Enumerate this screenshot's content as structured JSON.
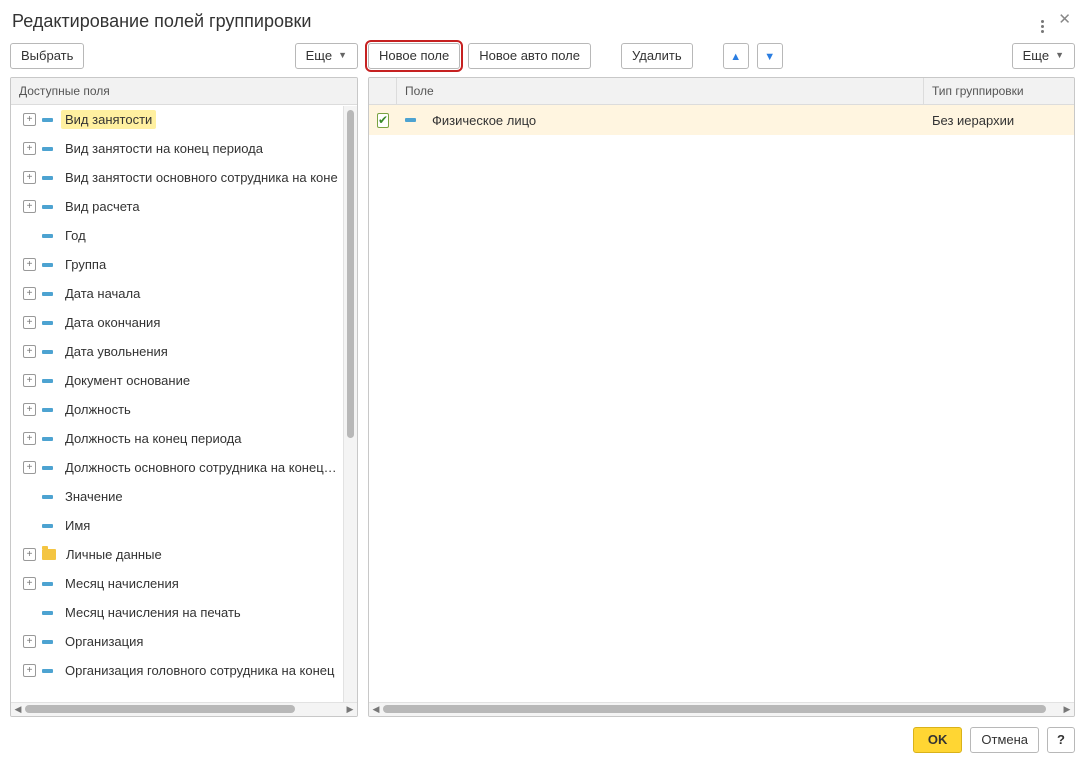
{
  "title": "Редактирование полей группировки",
  "left_toolbar": {
    "select": "Выбрать",
    "more": "Еще"
  },
  "right_toolbar": {
    "new_field": "Новое поле",
    "new_auto_field": "Новое авто поле",
    "delete": "Удалить",
    "more": "Еще"
  },
  "left_header": "Доступные поля",
  "right_header": {
    "field": "Поле",
    "group_type": "Тип группировки"
  },
  "available_fields": [
    {
      "label": "Вид занятости",
      "expandable": true,
      "selected": true
    },
    {
      "label": "Вид занятости на конец периода",
      "expandable": true
    },
    {
      "label": "Вид занятости основного сотрудника на коне",
      "expandable": true
    },
    {
      "label": "Вид расчета",
      "expandable": true
    },
    {
      "label": "Год",
      "expandable": false
    },
    {
      "label": "Группа",
      "expandable": true
    },
    {
      "label": "Дата начала",
      "expandable": true
    },
    {
      "label": "Дата окончания",
      "expandable": true
    },
    {
      "label": "Дата увольнения",
      "expandable": true
    },
    {
      "label": "Документ основание",
      "expandable": true
    },
    {
      "label": "Должность",
      "expandable": true
    },
    {
      "label": "Должность на конец периода",
      "expandable": true
    },
    {
      "label": "Должность основного сотрудника на конец пе",
      "expandable": true
    },
    {
      "label": "Значение",
      "expandable": false
    },
    {
      "label": "Имя",
      "expandable": false
    },
    {
      "label": "Личные данные",
      "expandable": true,
      "folder": true
    },
    {
      "label": "Месяц начисления",
      "expandable": true
    },
    {
      "label": "Месяц начисления на печать",
      "expandable": false
    },
    {
      "label": "Организация",
      "expandable": true
    },
    {
      "label": "Организация головного сотрудника на конец",
      "expandable": true
    }
  ],
  "group_fields": [
    {
      "checked": true,
      "label": "Физическое лицо",
      "type": "Без иерархии"
    }
  ],
  "footer": {
    "ok": "OK",
    "cancel": "Отмена",
    "help": "?"
  }
}
